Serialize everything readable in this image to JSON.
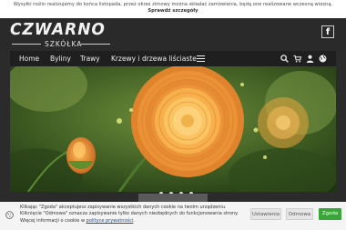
{
  "notice": {
    "line1": "Wysyłki roślin realizujemy do końca listopada, przez okres zimowy można składać zamówienia, będą one realizowane wczesną wiosną.",
    "line2": "Sprawdź szczegóły"
  },
  "logo": {
    "name": "CZWARNO",
    "subtitle": "SZKÓŁKA"
  },
  "social": {
    "facebook_label": "f"
  },
  "nav": {
    "items": [
      {
        "label": "Home"
      },
      {
        "label": "Byliny"
      },
      {
        "label": "Trawy"
      },
      {
        "label": "Krzewy i drzewa liściaste"
      }
    ],
    "icons": [
      "search-icon",
      "cart-icon",
      "user-icon",
      "globe-icon"
    ]
  },
  "hero": {
    "slides": 4,
    "active_slide": 1
  },
  "cookie": {
    "line1": "Klikając \"Zgoda\" akceptujesz zapisywanie wszystkich danych cookie na twoim urządzeniu.",
    "line2": "Kliknięcie \"Odmowa\" oznacza zapisywanie tylko danych niezbędnych do funkcjonowania strony.",
    "line3_prefix": "Więcej informacji o cookie w ",
    "line3_link": "polityce prywatności",
    "line3_suffix": ".",
    "btn_settings": "Ustawienia",
    "btn_decline": "Odmowa",
    "btn_accept": "Zgoda"
  },
  "colors": {
    "nav_bg": "#1f1f1f",
    "header_bg": "#2a2a2a",
    "accept_green": "#3aa63a"
  }
}
